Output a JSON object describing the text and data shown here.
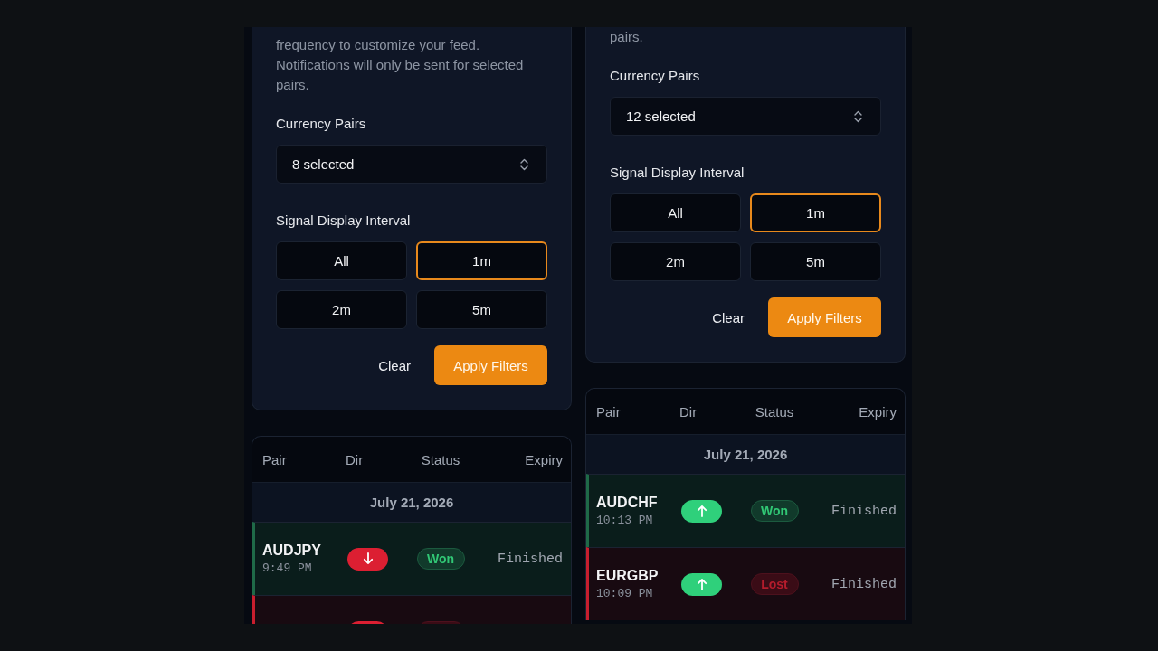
{
  "screens": [
    {
      "description": "frequency to customize your feed. Notifications will only be sent for selected pairs.",
      "currency_pairs": {
        "label": "Currency Pairs",
        "value": "8 selected"
      },
      "interval": {
        "label": "Signal Display Interval",
        "options": [
          {
            "label": "All",
            "selected": false
          },
          {
            "label": "1m",
            "selected": true
          },
          {
            "label": "2m",
            "selected": false
          },
          {
            "label": "5m",
            "selected": false
          }
        ]
      },
      "actions": {
        "clear": "Clear",
        "apply": "Apply Filters"
      },
      "table": {
        "columns": [
          "Pair",
          "Dir",
          "Status",
          "Expiry"
        ],
        "date": "July 21, 2026",
        "rows": [
          {
            "pair": "AUDJPY",
            "time": "9:49 PM",
            "up": false,
            "status": {
              "label": "Won",
              "kind": "won"
            },
            "expiry": "Finished"
          },
          {
            "up": false,
            "status": {
              "kind": "lost"
            }
          }
        ]
      }
    },
    {
      "description": "pairs.",
      "currency_pairs": {
        "label": "Currency Pairs",
        "value": "12 selected"
      },
      "interval": {
        "label": "Signal Display Interval",
        "options": [
          {
            "label": "All",
            "selected": false
          },
          {
            "label": "1m",
            "selected": true
          },
          {
            "label": "2m",
            "selected": false
          },
          {
            "label": "5m",
            "selected": false
          }
        ]
      },
      "actions": {
        "clear": "Clear",
        "apply": "Apply Filters"
      },
      "table": {
        "columns": [
          "Pair",
          "Dir",
          "Status",
          "Expiry"
        ],
        "date": "July 21, 2026",
        "rows": [
          {
            "pair": "AUDCHF",
            "time": "10:13 PM",
            "up": true,
            "status": {
              "label": "Won",
              "kind": "won"
            },
            "expiry": "Finished"
          },
          {
            "pair": "EURGBP",
            "time": "10:09 PM",
            "up": true,
            "status": {
              "label": "Lost",
              "kind": "lost"
            },
            "expiry": "Finished"
          }
        ]
      }
    }
  ]
}
